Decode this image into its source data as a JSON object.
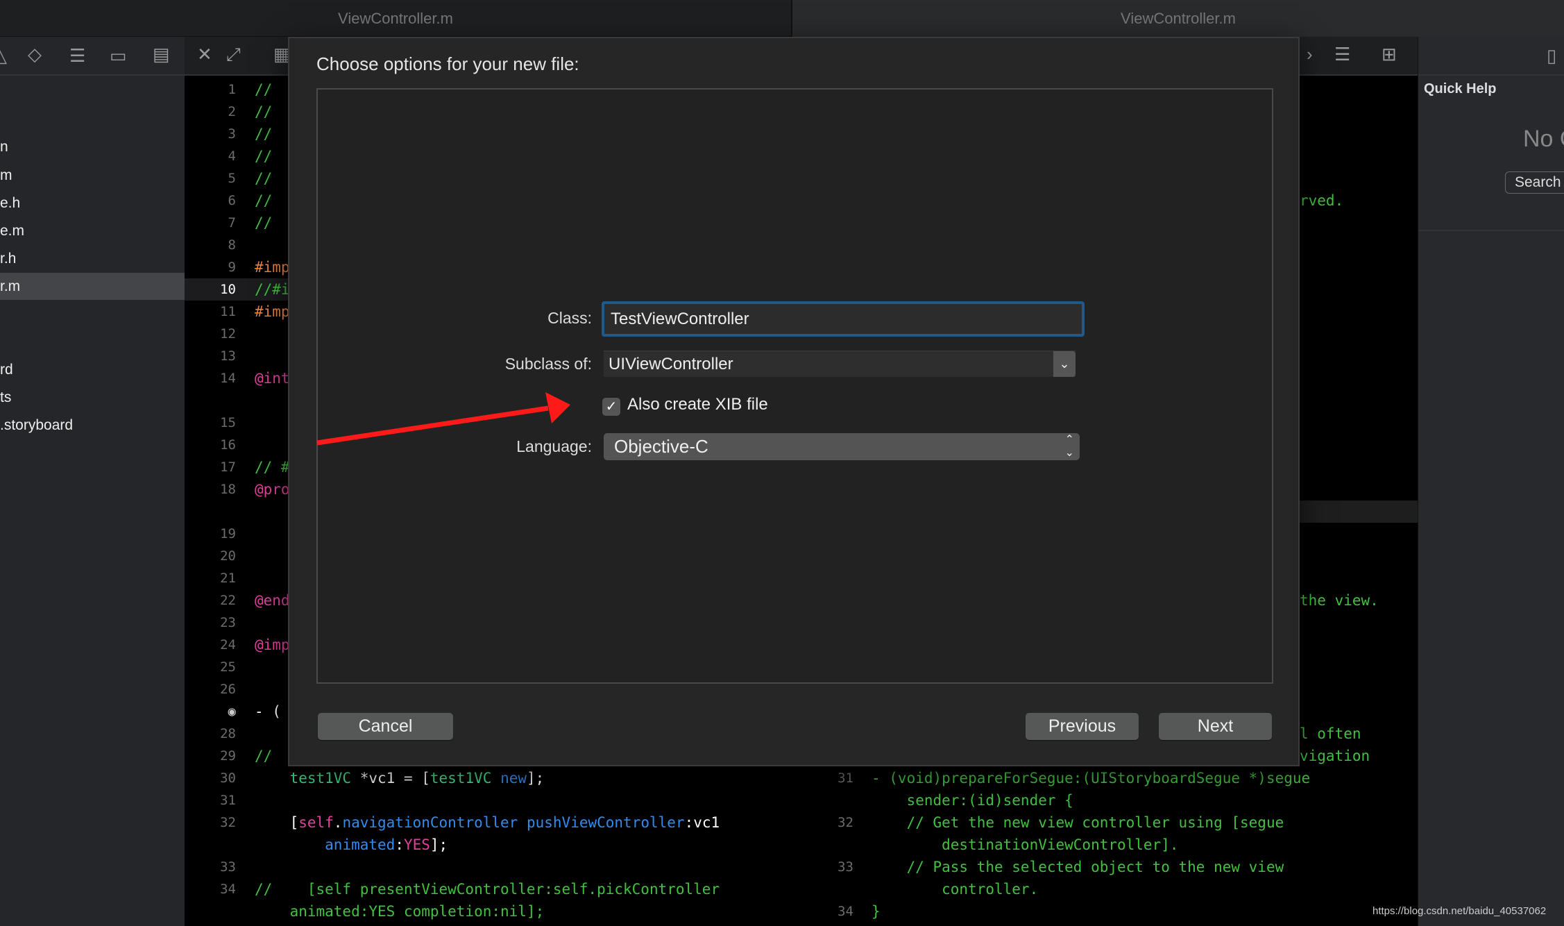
{
  "tabs": [
    {
      "label": "ViewController.m"
    },
    {
      "label": "ViewController.m"
    }
  ],
  "sidebar": {
    "items": [
      {
        "label": "n"
      },
      {
        "label": "m"
      },
      {
        "label": "e.h"
      },
      {
        "label": "e.m"
      },
      {
        "label": "r.h"
      },
      {
        "label": "r.m",
        "selected": true
      },
      {
        "label": "rd"
      },
      {
        "label": "ts"
      },
      {
        "label": ".storyboard"
      }
    ]
  },
  "left_editor": {
    "current_line": "10",
    "rows": [
      {
        "n": "1",
        "t": [
          [
            "com",
            "//"
          ]
        ]
      },
      {
        "n": "2",
        "t": [
          [
            "com",
            "//"
          ]
        ]
      },
      {
        "n": "3",
        "t": [
          [
            "com",
            "//"
          ]
        ]
      },
      {
        "n": "4",
        "t": [
          [
            "com",
            "//"
          ]
        ]
      },
      {
        "n": "5",
        "t": [
          [
            "com",
            "//"
          ]
        ]
      },
      {
        "n": "6",
        "t": [
          [
            "com",
            "//"
          ]
        ]
      },
      {
        "n": "7",
        "t": [
          [
            "com",
            "//"
          ]
        ]
      },
      {
        "n": "8",
        "t": []
      },
      {
        "n": "9",
        "t": [
          [
            "pre",
            "#imp"
          ]
        ]
      },
      {
        "n": "10",
        "t": [
          [
            "com",
            "//#i"
          ]
        ]
      },
      {
        "n": "11",
        "t": [
          [
            "pre",
            "#imp"
          ]
        ]
      },
      {
        "n": "12",
        "t": []
      },
      {
        "n": "13",
        "t": []
      },
      {
        "n": "14",
        "t": [
          [
            "kw",
            "@int"
          ]
        ]
      },
      {
        "n": "",
        "t": []
      },
      {
        "n": "15",
        "t": []
      },
      {
        "n": "16",
        "t": []
      },
      {
        "n": "17",
        "t": [
          [
            "com",
            "// #"
          ]
        ]
      },
      {
        "n": "18",
        "t": [
          [
            "kw",
            "@pro"
          ]
        ]
      },
      {
        "n": "",
        "t": []
      },
      {
        "n": "19",
        "t": []
      },
      {
        "n": "20",
        "t": []
      },
      {
        "n": "21",
        "t": []
      },
      {
        "n": "22",
        "t": [
          [
            "kw",
            "@end"
          ]
        ]
      },
      {
        "n": "23",
        "t": []
      },
      {
        "n": "24",
        "t": [
          [
            "kw",
            "@imp"
          ]
        ]
      },
      {
        "n": "25",
        "t": []
      },
      {
        "n": "26",
        "t": []
      },
      {
        "n": "",
        "bp": true,
        "t": [
          [
            "pl",
            "- ("
          ]
        ]
      },
      {
        "n": "28",
        "t": []
      },
      {
        "n": "29",
        "t": [
          [
            "com",
            "//"
          ]
        ]
      },
      {
        "n": "30",
        "t": [
          [
            "pl",
            "    "
          ],
          [
            "type",
            "test1VC"
          ],
          [
            "pl",
            " *vc1 = ["
          ],
          [
            "type",
            "test1VC"
          ],
          [
            "pl",
            " "
          ],
          [
            "fn",
            "new"
          ],
          [
            "pl",
            "];"
          ]
        ]
      },
      {
        "n": "31",
        "t": []
      },
      {
        "n": "32",
        "t": [
          [
            "pl",
            "    ["
          ],
          [
            "kw",
            "self"
          ],
          [
            "pl",
            "."
          ],
          [
            "fn",
            "navigationController"
          ],
          [
            "pl",
            " "
          ],
          [
            "fn",
            "pushViewController"
          ],
          [
            "pl",
            ":vc1"
          ]
        ]
      },
      {
        "n": "",
        "t": [
          [
            "pl",
            "        "
          ],
          [
            "fn",
            "animated"
          ],
          [
            "pl",
            ":"
          ],
          [
            "kw",
            "YES"
          ],
          [
            "pl",
            "];"
          ]
        ]
      },
      {
        "n": "33",
        "t": []
      },
      {
        "n": "34",
        "t": [
          [
            "com",
            "//    [self presentViewController:self.pickController"
          ]
        ]
      },
      {
        "n": "",
        "t": [
          [
            "com",
            "    animated:YES completion:nil];"
          ]
        ]
      }
    ]
  },
  "right_editor": {
    "fragments": [
      {
        "row": 5,
        "text": "rved."
      },
      {
        "row": 23,
        "text": "the view."
      },
      {
        "row": 29,
        "text": "l often"
      },
      {
        "row": 30,
        "text": "vigation"
      }
    ],
    "rows": [
      {
        "row": 31,
        "n": "31",
        "text": "- (void)prepareForSegue:(UIStoryboardSegue *)segue"
      },
      {
        "row": 32,
        "n": "",
        "text": "    sender:(id)sender {"
      },
      {
        "row": 33,
        "n": "32",
        "text": "    // Get the new view controller using [segue"
      },
      {
        "row": 34,
        "n": "",
        "text": "        destinationViewController]."
      },
      {
        "row": 35,
        "n": "33",
        "text": "    // Pass the selected object to the new view"
      },
      {
        "row": 36,
        "n": "",
        "text": "        controller."
      },
      {
        "row": 37,
        "n": "34",
        "text": "}"
      }
    ]
  },
  "quick_help": {
    "title": "Quick Help",
    "empty_text": "No C",
    "search_label": "Search"
  },
  "dialog": {
    "title": "Choose options for your new file:",
    "class_label": "Class:",
    "class_value": "TestViewController",
    "subclass_label": "Subclass of:",
    "subclass_value": "UIViewController",
    "xib_label": "Also create XIB file",
    "xib_checked": true,
    "language_label": "Language:",
    "language_value": "Objective-C",
    "cancel": "Cancel",
    "previous": "Previous",
    "next": "Next"
  },
  "annotation": {
    "color": "#ff1a1a"
  },
  "watermark": "https://blog.csdn.net/baidu_40537062"
}
